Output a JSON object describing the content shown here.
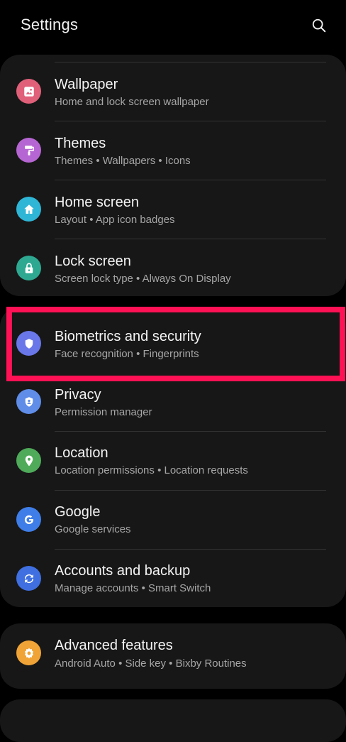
{
  "header": {
    "title": "Settings",
    "search_icon": "search-icon"
  },
  "highlight_color": "#ff1155",
  "groups": [
    {
      "items": [
        {
          "title": "Wallpaper",
          "subtitle": "Home and lock screen wallpaper",
          "icon": "wallpaper-icon",
          "color": "#e0607a"
        },
        {
          "title": "Themes",
          "subtitle": "Themes  •  Wallpapers  •  Icons",
          "icon": "paint-roller-icon",
          "color": "#b666d2"
        },
        {
          "title": "Home screen",
          "subtitle": "Layout  •  App icon badges",
          "icon": "home-icon",
          "color": "#2fb5d6"
        },
        {
          "title": "Lock screen",
          "subtitle": "Screen lock type  •  Always On Display",
          "icon": "lock-icon",
          "color": "#2ea891"
        }
      ]
    },
    {
      "items": [
        {
          "title": "Biometrics and security",
          "subtitle": "Face recognition  •  Fingerprints",
          "icon": "shield-icon",
          "color": "#6a77e8"
        },
        {
          "title": "Privacy",
          "subtitle": "Permission manager",
          "icon": "privacy-shield-icon",
          "color": "#5f8de8"
        },
        {
          "title": "Location",
          "subtitle": "Location permissions  •  Location requests",
          "icon": "location-pin-icon",
          "color": "#4faa5a"
        },
        {
          "title": "Google",
          "subtitle": "Google services",
          "icon": "google-icon",
          "color": "#3f7ee8"
        },
        {
          "title": "Accounts and backup",
          "subtitle": "Manage accounts  •  Smart Switch",
          "icon": "sync-icon",
          "color": "#3f6fe0"
        }
      ]
    },
    {
      "items": [
        {
          "title": "Advanced features",
          "subtitle": "Android Auto  •  Side key  •  Bixby Routines",
          "icon": "gear-icon",
          "color": "#f0a336"
        }
      ]
    }
  ]
}
